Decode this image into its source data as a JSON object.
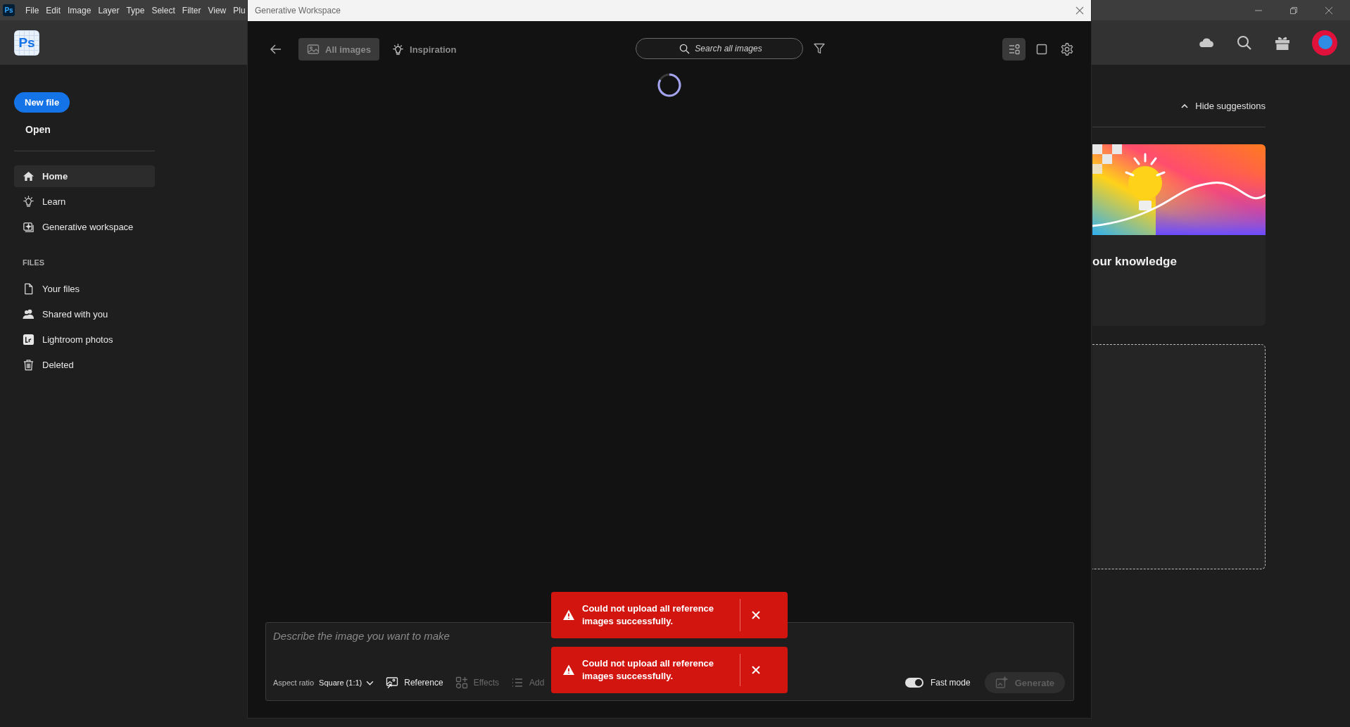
{
  "menu_bar": {
    "app_badge": "Ps",
    "items": [
      "File",
      "Edit",
      "Image",
      "Layer",
      "Type",
      "Select",
      "Filter",
      "View",
      "Plu"
    ]
  },
  "header": {
    "logo": "Ps"
  },
  "sidebar": {
    "new_file": "New file",
    "open": "Open",
    "nav": [
      {
        "label": "Home",
        "selected": true
      },
      {
        "label": "Learn",
        "selected": false
      },
      {
        "label": "Generative workspace",
        "selected": false
      }
    ],
    "files_heading": "FILES",
    "files": [
      {
        "label": "Your files",
        "selected": false
      },
      {
        "label": "Shared with you",
        "selected": false
      },
      {
        "label": "Lightroom photos",
        "selected": false
      },
      {
        "label": "Deleted",
        "selected": false
      }
    ]
  },
  "right_panel": {
    "hide_suggestions": "Hide suggestions",
    "card_title": "our knowledge"
  },
  "dialog": {
    "title": "Generative Workspace",
    "tabs": [
      {
        "label": "All images",
        "selected": true
      },
      {
        "label": "Inspiration",
        "selected": false
      }
    ],
    "search": {
      "placeholder": "Search all images"
    },
    "view_modes": [
      {
        "kind": "list",
        "selected": true
      },
      {
        "kind": "single",
        "selected": false
      }
    ],
    "prompt": {
      "placeholder": "Describe the image you want to make",
      "aspect_label": "Aspect ratio",
      "aspect_value": "Square (1:1)",
      "tools": [
        {
          "label": "Reference",
          "disabled": false
        },
        {
          "label": "Effects",
          "disabled": true
        },
        {
          "label": "Add",
          "disabled": true
        }
      ],
      "fast_mode": {
        "label": "Fast mode",
        "on": true
      },
      "generate": {
        "label": "Generate",
        "disabled": true
      }
    },
    "toasts": [
      {
        "message": "Could not upload all reference images successfully."
      },
      {
        "message": "Could not upload all reference images successfully."
      }
    ]
  }
}
